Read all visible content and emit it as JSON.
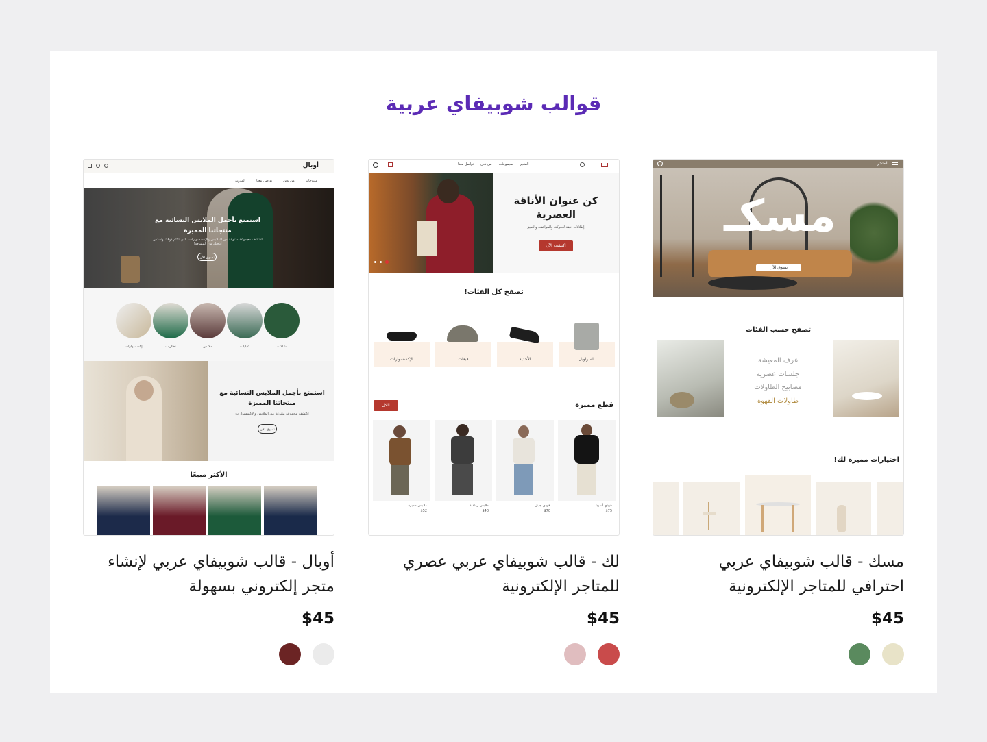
{
  "section": {
    "title": "قوالب شوبيفاي عربية"
  },
  "colors": {
    "title": "#5b2bb5",
    "background": "#efeff1"
  },
  "cards": [
    {
      "title_line1": "مسك - قالب شوبيفاي عربي",
      "title_line2": "احترافي للمتاجر الإلكترونية",
      "price": "$45",
      "swatches": [
        "#e8e3c8",
        "#5a8a5e"
      ],
      "preview": {
        "logo": "مسكـ",
        "hero_button": "تسوق الآن",
        "section_heading": "تصفح حسب الفئات",
        "categories": [
          "غرف المعيشة",
          "جلسات عصرية",
          "مصابيح الطاولات",
          "طاولات القهوة"
        ],
        "featured_heading": "اختيارات مميزة لك!",
        "nav": [
          "المتجر"
        ]
      }
    },
    {
      "title_line1": "لك - قالب شوبيفاي عربي عصري",
      "title_line2": "للمتاجر الإلكترونية",
      "price": "$45",
      "swatches": [
        "#c94b4b",
        "#e0bdbf"
      ],
      "preview": {
        "nav": [
          "المتجر",
          "مجموعات",
          "من نحن",
          "تواصل معنا"
        ],
        "hero_title": "كن عنوان الأناقة العصرية",
        "hero_sub": "إطلالات أنيقة للحركة، والمواقف، والتميز",
        "hero_button": "اكتشف الآن",
        "categories_heading": "تصفح كل الفئات!",
        "categories": [
          "السراويل",
          "الأحذية",
          "قبعات",
          "الإكسسوارات"
        ],
        "featured_heading": "قطع مميزة",
        "featured_button": "الكل",
        "products": [
          {
            "name": "هودي أسود",
            "price": "$75"
          },
          {
            "name": "هودي جينز",
            "price": "$70"
          },
          {
            "name": "ملابس رمادية",
            "price": "$40"
          },
          {
            "name": "ملابس مميزة",
            "price": "$52"
          }
        ]
      }
    },
    {
      "title_line1": "أوبال - قالب شوبيفاي عربي لإنشاء",
      "title_line2": "متجر إلكتروني بسهولة",
      "price": "$45",
      "swatches": [
        "#ebebeb",
        "#6b2424"
      ],
      "preview": {
        "logo": "أوبال",
        "nav": [
          "منتوجاتنا",
          "من نحن",
          "تواصل معنا",
          "المدونة"
        ],
        "hero_title": "استمتع بأجمل الملابس النسائية مع منتجاتنا المميزة",
        "hero_sub": "اكتشف مجموعة متنوعة من الملابس والإكسسوارات، التي تلائم ذوقك وتعكس أناقتك من المسافة!",
        "hero_button": "تسوق الآن",
        "circles": [
          "شالات",
          "عبايات",
          "ملابس",
          "نظارات",
          "إكسسوارات"
        ],
        "banner_title": "استمتع بأجمل الملابس النسائية مع منتجاتنا المميزة",
        "banner_sub": "اكتشف مجموعة متنوعة من الملابس والإكسسوارات",
        "banner_button": "تسوق الآن",
        "bestsellers_heading": "الأكثر مبيعًا"
      }
    }
  ]
}
